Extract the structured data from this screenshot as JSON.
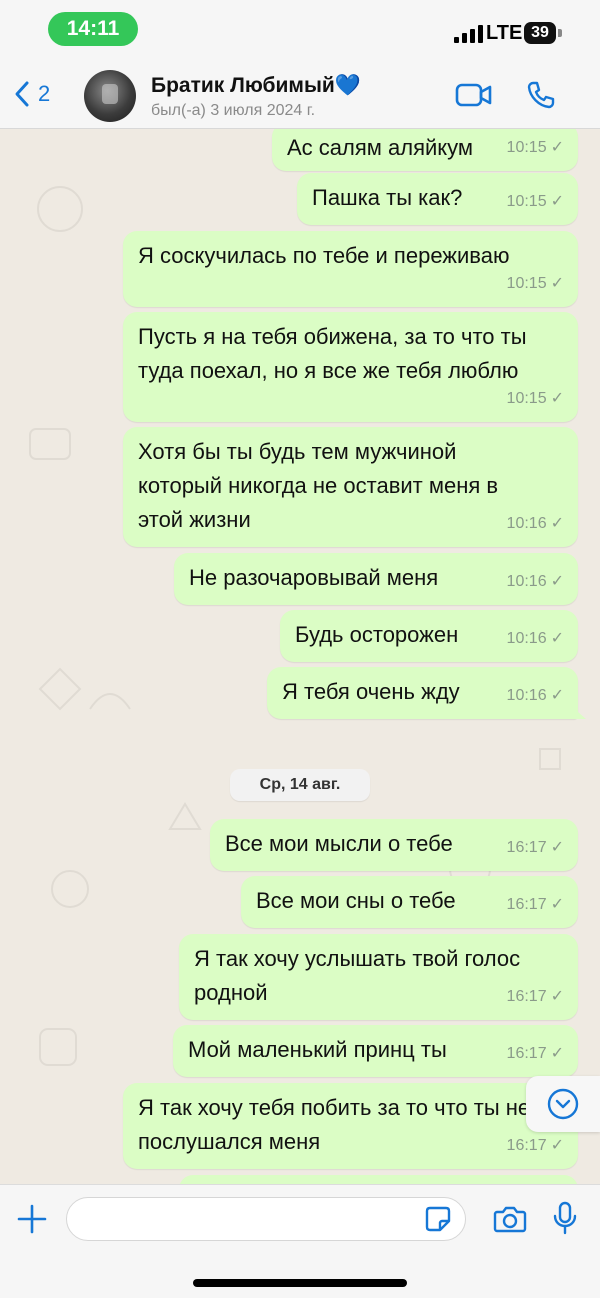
{
  "status_bar": {
    "time": "14:11",
    "network": "LTE",
    "battery": "39"
  },
  "header": {
    "back_count": "2",
    "contact_name": "Братик Любимый💙",
    "last_seen": "был(-а) 3 июля 2024 г."
  },
  "messages": [
    {
      "text": "Ас салям аляйкум",
      "time": "10:15"
    },
    {
      "text": "Пашка ты как?",
      "time": "10:15"
    },
    {
      "text": "Я соскучилась по тебе и переживаю",
      "time": "10:15"
    },
    {
      "text": "Пусть я на тебя обижена, за то что ты\nтуда поехал, но я все же тебя люблю",
      "time": "10:15"
    },
    {
      "text": "Хотя бы ты будь тем мужчиной\nкоторый никогда не оставит меня в\nэтой жизни",
      "time": "10:16"
    },
    {
      "text": "Не разочаровывай меня",
      "time": "10:16"
    },
    {
      "text": "Будь осторожен",
      "time": "10:16"
    },
    {
      "text": "Я тебя очень жду",
      "time": "10:16"
    },
    {
      "text": "Все мои мысли о тебе",
      "time": "16:17"
    },
    {
      "text": "Все мои сны о тебе",
      "time": "16:17"
    },
    {
      "text": "Я так хочу услышать твой голос\nродной",
      "time": "16:17"
    },
    {
      "text": "Мой маленький принц ты",
      "time": "16:17"
    },
    {
      "text": "Я так хочу тебя побить за то что ты не\nпослушался меня",
      "time": "16:17"
    }
  ],
  "date_divider": "Ср, 14 авг.",
  "input": {
    "placeholder": ""
  },
  "colors": {
    "bubble": "#dbfdc5",
    "accent": "#1677d6",
    "status_pill": "#34c759",
    "background": "#efeae2"
  }
}
